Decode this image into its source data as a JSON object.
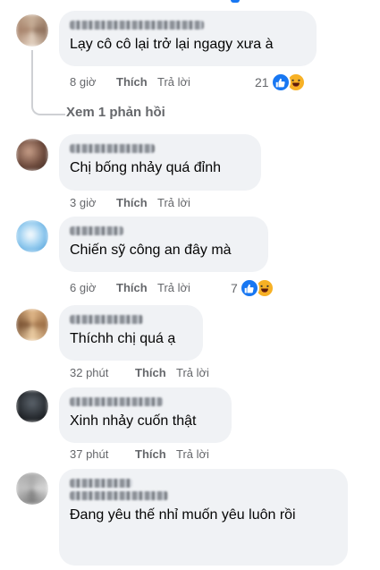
{
  "comments": [
    {
      "text": "Lạy cô cô lại trở lại ngagy xưa à",
      "time": "8 giờ",
      "like": "Thích",
      "reply": "Trả lời",
      "reaction_count": "21"
    },
    {
      "text": "Chị bống nhảy quá đỉnh",
      "time": "3 giờ",
      "like": "Thích",
      "reply": "Trả lời"
    },
    {
      "text": "Chiến sỹ công an đây mà",
      "time": "6 giờ",
      "like": "Thích",
      "reply": "Trả lời",
      "reaction_count": "7"
    },
    {
      "text": "Thíchh chị quá ạ",
      "time": "32 phút",
      "like": "Thích",
      "reply": "Trả lời"
    },
    {
      "text": "Xinh nhảy cuốn thật",
      "time": "37 phút",
      "like": "Thích",
      "reply": "Trả lời"
    },
    {
      "text": "Đang yêu thế nhỉ muốn yêu luôn rồi"
    }
  ],
  "view_replies": "Xem 1 phản hồi",
  "icons": {
    "like": "thumbs-up-icon",
    "haha": "laughing-face-icon"
  },
  "colors": {
    "like_blue": "#1877f2",
    "haha_yellow": "#f7b125",
    "bubble": "#f0f2f5",
    "meta_gray": "#65676b"
  }
}
